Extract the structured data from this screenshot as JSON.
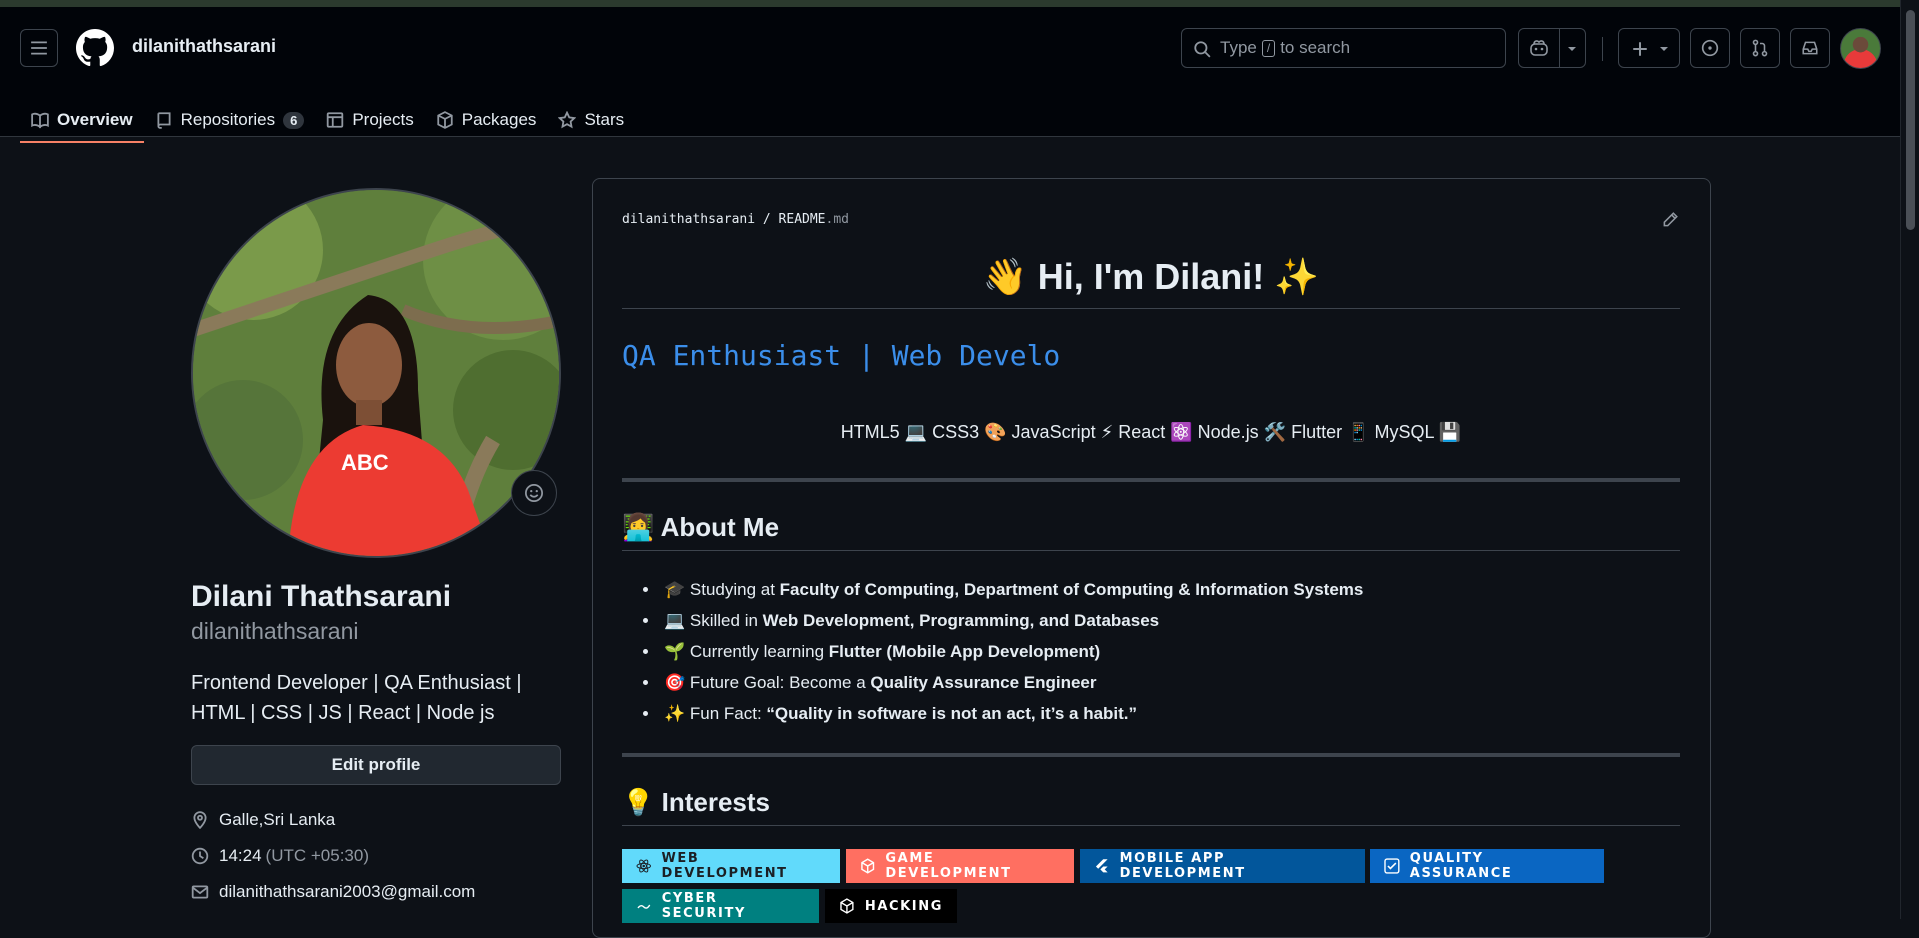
{
  "header": {
    "username": "dilanithathsarani",
    "search_prefix": "Type",
    "search_key": "/",
    "search_suffix": "to search"
  },
  "tabs": [
    {
      "label": "Overview"
    },
    {
      "label": "Repositories",
      "count": "6"
    },
    {
      "label": "Projects"
    },
    {
      "label": "Packages"
    },
    {
      "label": "Stars"
    }
  ],
  "profile": {
    "full_name": "Dilani Thathsarani",
    "login": "dilanithathsarani",
    "bio_line1": "Frontend Developer | QA Enthusiast |",
    "bio_line2": "HTML | CSS | JS | React | Node js",
    "edit_label": "Edit profile",
    "location": "Galle,Sri Lanka",
    "time": "14:24",
    "timezone": "(UTC +05:30)",
    "email": "dilanithathsarani2003@gmail.com"
  },
  "readme": {
    "path_user": "dilanithathsarani",
    "path_sep": "/",
    "path_file": "README",
    "path_ext": ".md",
    "greeting": "👋 Hi, I'm Dilani! ✨",
    "typing_text": "QA Enthusiast | Web Develo",
    "tech_line": "HTML5 💻 CSS3 🎨 JavaScript ⚡ React ⚛️ Node.js 🛠️ Flutter 📱 MySQL 💾",
    "about_heading": "👩‍💻 About Me",
    "about_items": [
      {
        "prefix": "🎓 Studying at ",
        "bold": "Faculty of Computing, Department of Computing & Information Systems"
      },
      {
        "prefix": "💻 Skilled in ",
        "bold": "Web Development, Programming, and Databases"
      },
      {
        "prefix": "🌱 Currently learning ",
        "bold": "Flutter (Mobile App Development)"
      },
      {
        "prefix": "🎯 Future Goal: Become a ",
        "bold": "Quality Assurance Engineer"
      },
      {
        "prefix": "✨ Fun Fact: ",
        "bold": "“Quality in software is not an act, it’s a habit.”"
      }
    ],
    "interests_heading": "💡 Interests",
    "badges": [
      {
        "label": "WEB DEVELOPMENT",
        "bg": "#61dafb",
        "fg": "#1b1f24",
        "icon": "react-icon"
      },
      {
        "label": "GAME DEVELOPMENT",
        "bg": "#ff6f61",
        "fg": "#ffffff",
        "icon": "unity-icon"
      },
      {
        "label": "MOBILE APP DEVELOPMENT",
        "bg": "#02569b",
        "fg": "#ffffff",
        "icon": "flutter-icon"
      },
      {
        "label": "QUALITY ASSURANCE",
        "bg": "#0a66c2",
        "fg": "#ffffff",
        "icon": "selenium-icon"
      },
      {
        "label": "CYBER SECURITY",
        "bg": "#008080",
        "fg": "#ffffff",
        "icon": "security-icon"
      },
      {
        "label": "HACKING",
        "bg": "#000000",
        "fg": "#ffffff",
        "icon": "hack-icon"
      }
    ]
  },
  "colors": {
    "accent_tab": "#f78166",
    "link_blue": "#3b8eea",
    "bg": "#0d1117"
  }
}
